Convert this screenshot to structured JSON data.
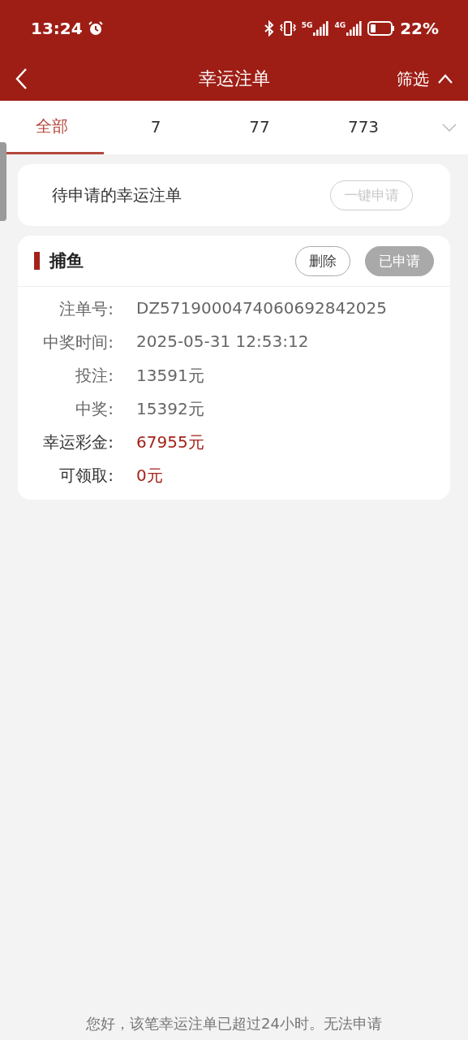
{
  "status_bar": {
    "time": "13:24",
    "networks": [
      "5G",
      "4G"
    ],
    "battery": "22%"
  },
  "header": {
    "title": "幸运注单",
    "filter": "筛选"
  },
  "tabs": [
    {
      "label": "全部",
      "selected": true
    },
    {
      "label": "7",
      "selected": false
    },
    {
      "label": "77",
      "selected": false
    },
    {
      "label": "773",
      "selected": false
    }
  ],
  "pending": {
    "label": "待申请的幸运注单",
    "button": {
      "label": "一键申请",
      "disabled": true
    }
  },
  "orders": [
    {
      "title": "捕鱼",
      "buttons": [
        {
          "label": "删除",
          "disabled": false
        },
        {
          "label": "已申请",
          "disabled": true
        }
      ],
      "fields": [
        {
          "label": "注单号:",
          "value": "DZ5719000474060692842025",
          "kind": "normal"
        },
        {
          "label": "中奖时间:",
          "value": "2025-05-31 12:53:12",
          "kind": "normal"
        },
        {
          "label": "投注:",
          "value": "13591元",
          "kind": "normal"
        },
        {
          "label": "中奖:",
          "value": "15392元",
          "kind": "normal"
        },
        {
          "label": "幸运彩金:",
          "value": "67955元",
          "kind": "highlight"
        },
        {
          "label": "可领取:",
          "value": "0元",
          "kind": "highlight"
        }
      ]
    }
  ],
  "footer": "您好，该笔幸运注单已超过24小时。无法申请"
}
